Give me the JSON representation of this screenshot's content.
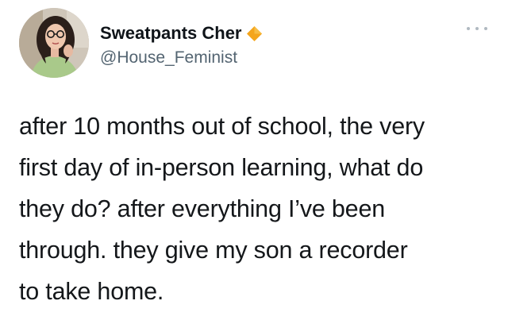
{
  "author": {
    "display_name": "Sweatpants Cher",
    "handle": "@House_Feminist",
    "avatar_icon": "profile-photo",
    "verified_icon": "orange-diamond-badge",
    "verified_color": "#f4a51c"
  },
  "menu": {
    "icon": "more-options-dots-icon"
  },
  "tweet": {
    "lines": [
      "after 10 months out of school, the very",
      "first day of in-person learning, what do",
      "they do? after everything I’ve been",
      "through. they give my son a recorder",
      "to take home."
    ]
  },
  "colors": {
    "text": "#14171a",
    "handle": "#536471",
    "background": "#ffffff"
  }
}
